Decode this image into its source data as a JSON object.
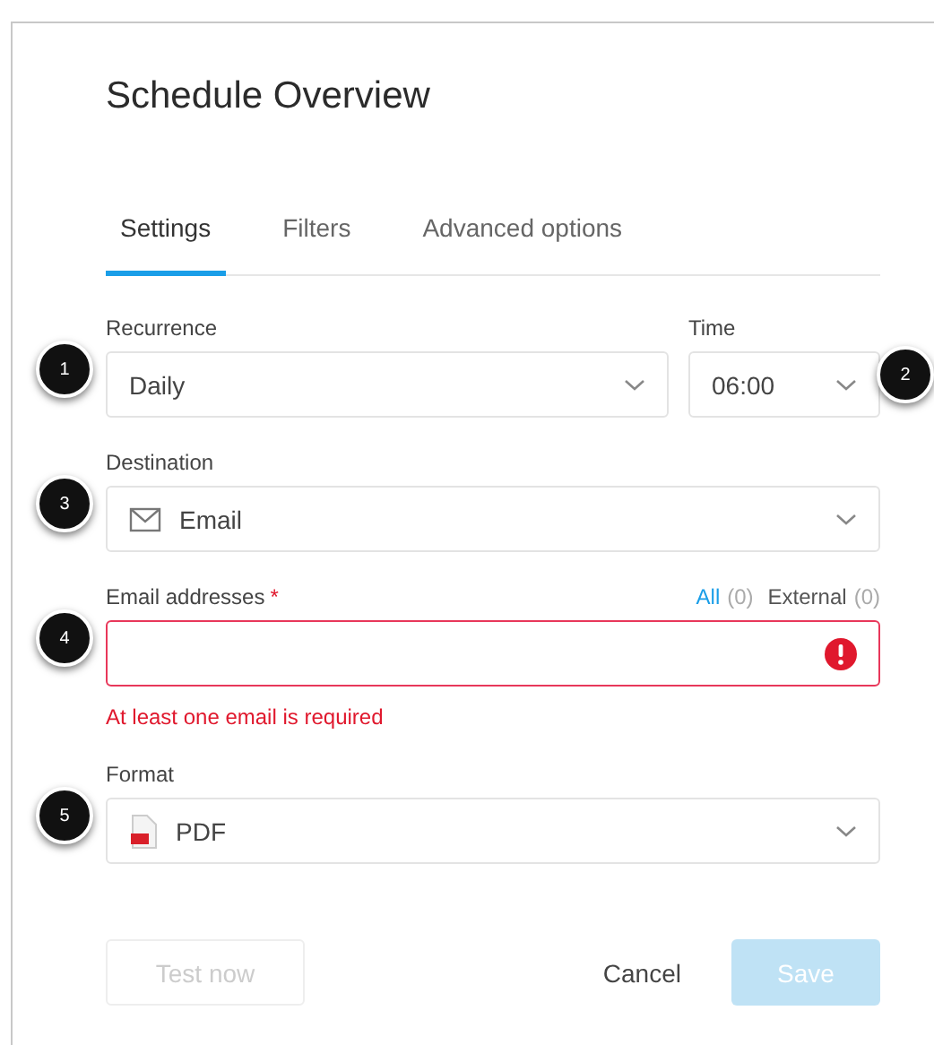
{
  "dialog": {
    "title": "Schedule Overview"
  },
  "tabs": [
    {
      "label": "Settings",
      "selected": true
    },
    {
      "label": "Filters",
      "selected": false
    },
    {
      "label": "Advanced options",
      "selected": false
    }
  ],
  "rows": [
    {
      "fields": [
        {
          "label": "Recurrence",
          "value": "Daily",
          "kind": "select",
          "callout": "1"
        },
        {
          "label": "Time",
          "value": "06:00",
          "kind": "select",
          "callout": "2"
        }
      ]
    },
    {
      "fields": [
        {
          "label": "Destination",
          "value": "Email",
          "kind": "mail",
          "callout": "3"
        }
      ]
    },
    {
      "fields": [
        {
          "label": "Email addresses",
          "required_mark": "*",
          "kind": "input",
          "error": true,
          "error_message": "At least one email is required",
          "callout": "4",
          "filters": [
            {
              "label": "All",
              "count": "(0)",
              "selected": true
            },
            {
              "label": "External",
              "count": "(0)",
              "selected": false
            }
          ]
        }
      ]
    },
    {
      "fields": [
        {
          "label": "Format",
          "value": "PDF",
          "kind": "file",
          "callout": "5"
        }
      ]
    }
  ],
  "buttons": [
    {
      "label": "Test now",
      "kind": "secondary",
      "disabled": true
    },
    {
      "label": "Cancel",
      "kind": "text",
      "disabled": false
    },
    {
      "label": "Save",
      "kind": "primary",
      "disabled": true
    }
  ]
}
